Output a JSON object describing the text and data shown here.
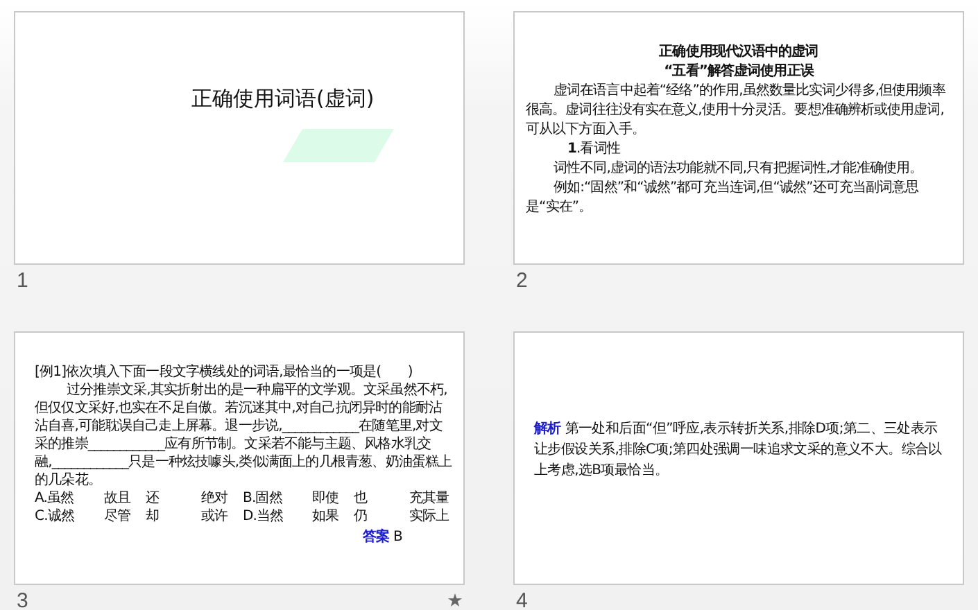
{
  "slides": [
    {
      "kind": "title",
      "number": "1",
      "animated": false,
      "title": "正确使用词语(虚词)"
    },
    {
      "kind": "text",
      "number": "2",
      "animated": false,
      "headings": [
        "正确使用现代汉语中的虚词",
        "“五看”解答虚词使用正误"
      ],
      "paragraphs": [
        "虚词在语言中起着“经络”的作用,虽然数量比实词少得多,但使用频率很高。虚词往往没有实在意义,使用十分灵活。要想准确辨析或使用虚词,可从以下方面入手。",
        "**1**.看词性",
        "词性不同,虚词的语法功能就不同,只有把握词性,才能准确使用。",
        "例如:“固然”和“诚然”都可充当连词,但“诚然”还可充当副词意思是“实在”。"
      ]
    },
    {
      "kind": "question",
      "number": "3",
      "animated": true,
      "question": "[例1]依次填入下面一段文字横线处的词语,最恰当的一项是(　　)",
      "passage": "过分推崇文采,其实折射出的是一种扁平的文学观。文采虽然不朽,但仅仅文采好,也实在不足自傲。若沉迷其中,对自己抗闭异时的能耐沾沾自喜,可能耽误自己走上屏幕。退一步说,____________在随笔里,对文采的推崇____________应有所节制。文采若不能与主题、风格水乳交融,____________只是一种炫技噱头,类似满面上的几根青葱、奶油蛋糕上的几朵花。",
      "options": [
        [
          "A.虽然",
          "故且",
          "还",
          "绝对"
        ],
        [
          "B.固然",
          "即使",
          "也",
          "充其量"
        ],
        [
          "C.诚然",
          "尽管",
          "却",
          "或许"
        ],
        [
          "D.当然",
          "如果",
          "仍",
          "实际上"
        ]
      ],
      "answer_label": "答案",
      "answer": "B"
    },
    {
      "kind": "analysis",
      "number": "4",
      "animated": false,
      "label": "解析",
      "text": "第一处和后面“但”呼应,表示转折关系,排除D项;第二、三处表示让步假设关系,排除C项;第四处强调一味追求文采的意义不大。综合以上考虑,选B项最恰当。"
    }
  ]
}
